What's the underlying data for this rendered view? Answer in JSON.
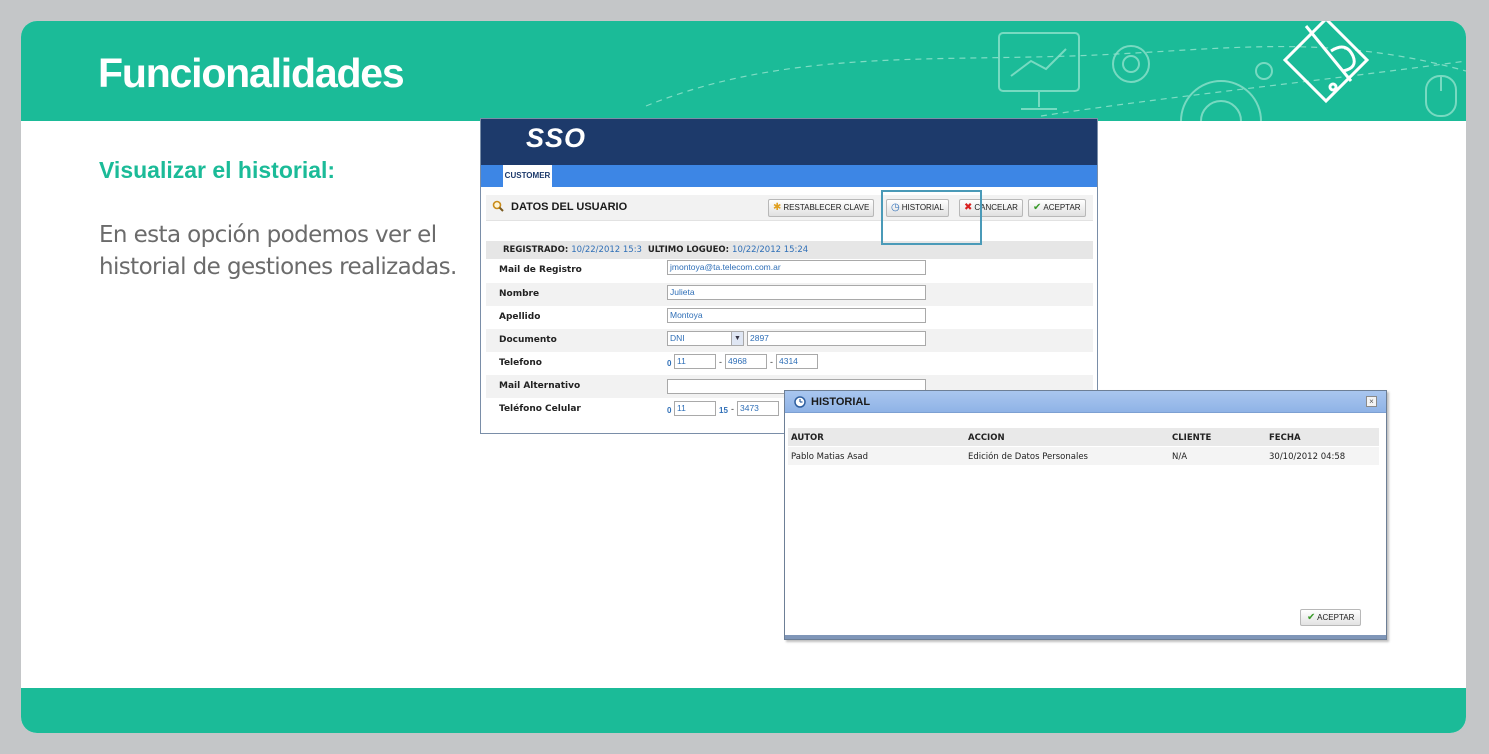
{
  "slide": {
    "title": "Funcionalidades",
    "subtitle": "Visualizar el historial:",
    "paragraph": "En esta opción podemos ver el historial de gestiones realizadas.",
    "accent_color": "#1bbb98"
  },
  "sso": {
    "logo": "SSO",
    "tab": "CUSTOMER",
    "section_title": "DATOS DEL USUARIO",
    "buttons": {
      "restablecer": "RESTABLECER CLAVE",
      "historial": "HISTORIAL",
      "cancelar": "CANCELAR",
      "aceptar": "ACEPTAR"
    },
    "registrado_label": "REGISTRADO:",
    "registrado_value": "10/22/2012 15:3",
    "ultimo_logueo_label": "ULTIMO LOGUEO:",
    "ultimo_logueo_value": "10/22/2012 15:24",
    "fields": {
      "mail_registro_label": "Mail de Registro",
      "mail_registro_value": "jmontoya@ta.telecom.com.ar",
      "nombre_label": "Nombre",
      "nombre_value": "Julieta",
      "apellido_label": "Apellido",
      "apellido_value": "Montoya",
      "documento_label": "Documento",
      "documento_tipo": "DNI",
      "documento_numero": "2897",
      "telefono_label": "Telefono",
      "telefono_prefix": "0",
      "telefono_area": "11",
      "telefono_part1": "4968",
      "telefono_part2": "4314",
      "mail_alt_label": "Mail Alternativo",
      "mail_alt_value": "",
      "celular_label": "Teléfono Celular",
      "celular_prefix": "0",
      "celular_area": "11",
      "celular_15": "15",
      "celular_part1": "3473"
    }
  },
  "historial": {
    "title": "HISTORIAL",
    "close": "×",
    "columns": [
      "AUTOR",
      "ACCION",
      "CLIENTE",
      "FECHA"
    ],
    "rows": [
      [
        "Pablo Matias Asad",
        "Edición de Datos Personales",
        "N/A",
        "30/10/2012 04:58"
      ]
    ],
    "ok_button": "ACEPTAR"
  }
}
